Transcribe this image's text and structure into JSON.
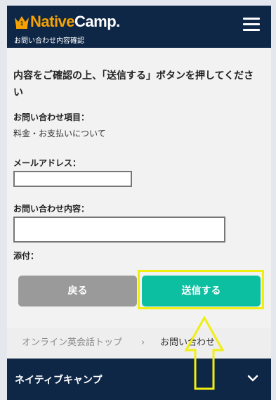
{
  "header": {
    "logo_part1": "Native",
    "logo_part2": "Camp.",
    "subtitle": "お問い合わせ内容確認"
  },
  "form": {
    "instruction": "内容をご確認の上、「送信する」ボタンを押してください",
    "inquiry_item_label": "お問い合わせ項目：",
    "inquiry_item_value": "料金・お支払いについて",
    "email_label": "メールアドレス：",
    "email_value": "",
    "content_label": "お問い合わせ内容：",
    "content_value": "",
    "attachment_label": "添付："
  },
  "buttons": {
    "back_label": "戻る",
    "send_label": "送信する"
  },
  "breadcrumb": {
    "home": "オンライン英会話トップ",
    "separator": "›",
    "current": "お問い合わせ"
  },
  "footer": {
    "title": "ネイティブキャンプ"
  },
  "colors": {
    "header_bg": "#0f2747",
    "brand_orange": "#f5a200",
    "send_button": "#0dbfa1",
    "back_button": "#9a9a9a",
    "highlight_yellow": "#f0ee10"
  },
  "icons": {
    "logo": "crown-icon",
    "menu": "hamburger-menu-icon",
    "footer_toggle": "chevron-down-icon",
    "annotation": "up-arrow-annotation-icon"
  }
}
